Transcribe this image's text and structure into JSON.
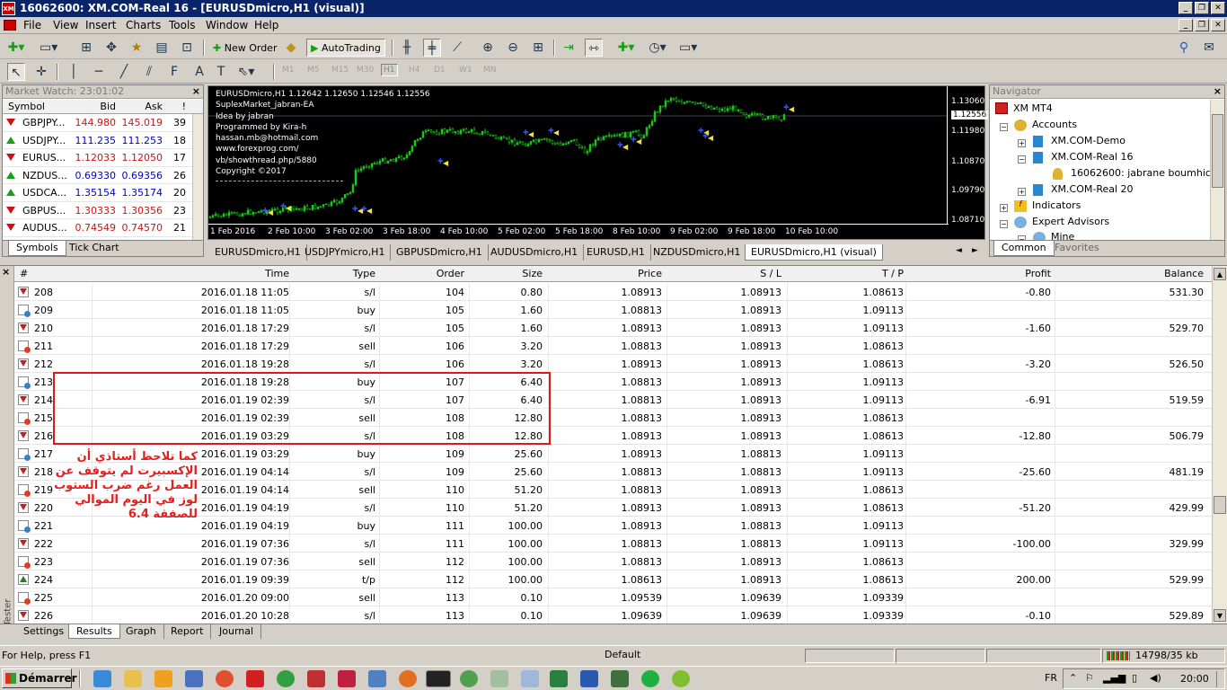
{
  "window": {
    "title": "16062600: XM.COM-Real 16 - [EURUSDmicro,H1 (visual)]",
    "logo_text": "XM"
  },
  "menu": [
    "File",
    "View",
    "Insert",
    "Charts",
    "Tools",
    "Window",
    "Help"
  ],
  "toolbar": {
    "new_order": "New Order",
    "autotrading": "AutoTrading"
  },
  "timeframes": [
    "M1",
    "M5",
    "M15",
    "M30",
    "H1",
    "H4",
    "D1",
    "W1",
    "MN"
  ],
  "market_watch": {
    "title": "Market Watch: 23:01:02",
    "headers": {
      "symbol": "Symbol",
      "bid": "Bid",
      "ask": "Ask",
      "spread": "!"
    },
    "rows": [
      {
        "symbol": "GBPJPY...",
        "bid": "144.980",
        "ask": "145.019",
        "spread": "39",
        "dir": "down",
        "color": "#d01010"
      },
      {
        "symbol": "USDJPY...",
        "bid": "111.235",
        "ask": "111.253",
        "spread": "18",
        "dir": "up",
        "color": "#0000c8"
      },
      {
        "symbol": "EURUS...",
        "bid": "1.12033",
        "ask": "1.12050",
        "spread": "17",
        "dir": "down",
        "color": "#d01010"
      },
      {
        "symbol": "NZDUS...",
        "bid": "0.69330",
        "ask": "0.69356",
        "spread": "26",
        "dir": "up",
        "color": "#0000c8"
      },
      {
        "symbol": "USDCA...",
        "bid": "1.35154",
        "ask": "1.35174",
        "spread": "20",
        "dir": "up",
        "color": "#0000c8"
      },
      {
        "symbol": "GBPUS...",
        "bid": "1.30333",
        "ask": "1.30356",
        "spread": "23",
        "dir": "down",
        "color": "#d01010"
      },
      {
        "symbol": "AUDUS...",
        "bid": "0.74549",
        "ask": "0.74570",
        "spread": "21",
        "dir": "down",
        "color": "#d01010"
      }
    ],
    "tabs": [
      "Symbols",
      "Tick Chart"
    ]
  },
  "chart": {
    "info_lines": [
      "EURUSDmicro,H1  1.12642 1.12650 1.12546 1.12556",
      "SuplexMarket_jabran-EA",
      "Idea by jabran",
      "Programmed by Kira-h",
      "hassan.mb@hotmail.com",
      "www.forexprog.com/",
      "vb/showthread.php/5880",
      "Copyright ©2017"
    ],
    "price_labels": [
      "1.13060",
      "1.12556",
      "1.11980",
      "1.10870",
      "1.09790",
      "1.08710"
    ],
    "current_price": "1.12556",
    "time_labels": [
      "1 Feb 2016",
      "2 Feb 10:00",
      "3 Feb 02:00",
      "3 Feb 18:00",
      "4 Feb 10:00",
      "5 Feb 02:00",
      "5 Feb 18:00",
      "8 Feb 10:00",
      "9 Feb 02:00",
      "9 Feb 18:00",
      "10 Feb 10:00"
    ],
    "tabs": [
      "EURUSDmicro,H1",
      "USDJPYmicro,H1",
      "GBPUSDmicro,H1",
      "AUDUSDmicro,H1",
      "EURUSD,H1",
      "NZDUSDmicro,H1",
      "EURUSDmicro,H1 (visual)"
    ]
  },
  "navigator": {
    "title": "Navigator",
    "items": [
      "XM MT4",
      "Accounts",
      "XM.COM-Demo",
      "XM.COM-Real 16",
      "16062600: jabrane boumhicha",
      "XM.COM-Real 20",
      "Indicators",
      "Expert Advisors",
      "Mine"
    ],
    "tabs": [
      "Common",
      "Favorites"
    ]
  },
  "terminal": {
    "headers": {
      "num": "#",
      "time": "Time",
      "type": "Type",
      "order": "Order",
      "size": "Size",
      "price": "Price",
      "sl": "S / L",
      "tp": "T / P",
      "profit": "Profit",
      "balance": "Balance"
    },
    "rows": [
      {
        "num": "208",
        "time": "2016.01.18 11:05",
        "type": "s/l",
        "order": "104",
        "size": "0.80",
        "price": "1.08913",
        "sl": "1.08913",
        "tp": "1.08613",
        "profit": "-0.80",
        "balance": "531.30",
        "icon": "sl"
      },
      {
        "num": "209",
        "time": "2016.01.18 11:05",
        "type": "buy",
        "order": "105",
        "size": "1.60",
        "price": "1.08813",
        "sl": "1.08913",
        "tp": "1.09113",
        "profit": "",
        "balance": "",
        "icon": "buy"
      },
      {
        "num": "210",
        "time": "2016.01.18 17:29",
        "type": "s/l",
        "order": "105",
        "size": "1.60",
        "price": "1.08913",
        "sl": "1.08913",
        "tp": "1.09113",
        "profit": "-1.60",
        "balance": "529.70",
        "icon": "sl"
      },
      {
        "num": "211",
        "time": "2016.01.18 17:29",
        "type": "sell",
        "order": "106",
        "size": "3.20",
        "price": "1.08813",
        "sl": "1.08913",
        "tp": "1.08613",
        "profit": "",
        "balance": "",
        "icon": "sell"
      },
      {
        "num": "212",
        "time": "2016.01.18 19:28",
        "type": "s/l",
        "order": "106",
        "size": "3.20",
        "price": "1.08913",
        "sl": "1.08913",
        "tp": "1.08613",
        "profit": "-3.20",
        "balance": "526.50",
        "icon": "sl"
      },
      {
        "num": "213",
        "time": "2016.01.18 19:28",
        "type": "buy",
        "order": "107",
        "size": "6.40",
        "price": "1.08813",
        "sl": "1.08913",
        "tp": "1.09113",
        "profit": "",
        "balance": "",
        "icon": "buy"
      },
      {
        "num": "214",
        "time": "2016.01.19 02:39",
        "type": "s/l",
        "order": "107",
        "size": "6.40",
        "price": "1.08813",
        "sl": "1.08913",
        "tp": "1.09113",
        "profit": "-6.91",
        "balance": "519.59",
        "icon": "sl"
      },
      {
        "num": "215",
        "time": "2016.01.19 02:39",
        "type": "sell",
        "order": "108",
        "size": "12.80",
        "price": "1.08813",
        "sl": "1.08913",
        "tp": "1.08613",
        "profit": "",
        "balance": "",
        "icon": "sell"
      },
      {
        "num": "216",
        "time": "2016.01.19 03:29",
        "type": "s/l",
        "order": "108",
        "size": "12.80",
        "price": "1.08913",
        "sl": "1.08913",
        "tp": "1.08613",
        "profit": "-12.80",
        "balance": "506.79",
        "icon": "sl"
      },
      {
        "num": "217",
        "time": "2016.01.19 03:29",
        "type": "buy",
        "order": "109",
        "size": "25.60",
        "price": "1.08913",
        "sl": "1.08813",
        "tp": "1.09113",
        "profit": "",
        "balance": "",
        "icon": "buy"
      },
      {
        "num": "218",
        "time": "2016.01.19 04:14",
        "type": "s/l",
        "order": "109",
        "size": "25.60",
        "price": "1.08813",
        "sl": "1.08813",
        "tp": "1.09113",
        "profit": "-25.60",
        "balance": "481.19",
        "icon": "sl"
      },
      {
        "num": "219",
        "time": "2016.01.19 04:14",
        "type": "sell",
        "order": "110",
        "size": "51.20",
        "price": "1.08813",
        "sl": "1.08913",
        "tp": "1.08613",
        "profit": "",
        "balance": "",
        "icon": "sell"
      },
      {
        "num": "220",
        "time": "2016.01.19 04:19",
        "type": "s/l",
        "order": "110",
        "size": "51.20",
        "price": "1.08913",
        "sl": "1.08913",
        "tp": "1.08613",
        "profit": "-51.20",
        "balance": "429.99",
        "icon": "sl"
      },
      {
        "num": "221",
        "time": "2016.01.19 04:19",
        "type": "buy",
        "order": "111",
        "size": "100.00",
        "price": "1.08913",
        "sl": "1.08813",
        "tp": "1.09113",
        "profit": "",
        "balance": "",
        "icon": "buy"
      },
      {
        "num": "222",
        "time": "2016.01.19 07:36",
        "type": "s/l",
        "order": "111",
        "size": "100.00",
        "price": "1.08813",
        "sl": "1.08813",
        "tp": "1.09113",
        "profit": "-100.00",
        "balance": "329.99",
        "icon": "sl"
      },
      {
        "num": "223",
        "time": "2016.01.19 07:36",
        "type": "sell",
        "order": "112",
        "size": "100.00",
        "price": "1.08813",
        "sl": "1.08913",
        "tp": "1.08613",
        "profit": "",
        "balance": "",
        "icon": "sell"
      },
      {
        "num": "224",
        "time": "2016.01.19 09:39",
        "type": "t/p",
        "order": "112",
        "size": "100.00",
        "price": "1.08613",
        "sl": "1.08913",
        "tp": "1.08613",
        "profit": "200.00",
        "balance": "529.99",
        "icon": "tp"
      },
      {
        "num": "225",
        "time": "2016.01.20 09:00",
        "type": "sell",
        "order": "113",
        "size": "0.10",
        "price": "1.09539",
        "sl": "1.09639",
        "tp": "1.09339",
        "profit": "",
        "balance": "",
        "icon": "sell"
      },
      {
        "num": "226",
        "time": "2016.01.20 10:28",
        "type": "s/l",
        "order": "113",
        "size": "0.10",
        "price": "1.09639",
        "sl": "1.09639",
        "tp": "1.09339",
        "profit": "-0.10",
        "balance": "529.89",
        "icon": "sl"
      }
    ],
    "annotation_lines": [
      "كما تلاحظ أستاذي أن",
      "الإكسبيرت لم يتوقف عن",
      "العمل رغم ضرب الستوب",
      "لوز في اليوم الموالي",
      "للصفقة 6.4"
    ],
    "side_label": "Tester",
    "tabs": [
      "Settings",
      "Results",
      "Graph",
      "Report",
      "Journal"
    ]
  },
  "status": {
    "help": "For Help, press F1",
    "profile": "Default",
    "traffic": "14798/35 kb"
  },
  "taskbar": {
    "start": "Démarrer",
    "lang": "FR",
    "clock": "20:00"
  }
}
